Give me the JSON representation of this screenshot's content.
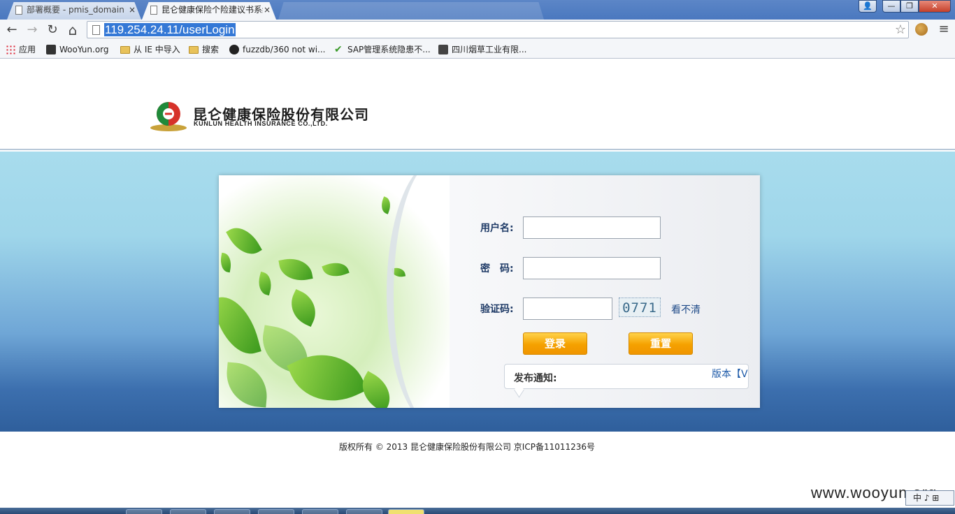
{
  "browser": {
    "tabs": [
      {
        "title": "部署概要 - pmis_domain",
        "close": "×"
      },
      {
        "title": "昆仑健康保险个险建议书系统",
        "close": "×"
      }
    ],
    "window_controls": {
      "minimize": "—",
      "maximize": "❐",
      "close": "✕",
      "user": "👤"
    },
    "nav": {
      "back": "←",
      "forward": "→",
      "reload": "↻",
      "home": "⌂"
    },
    "url": "119.254.24.11/userLogin",
    "bookmark_star": "☆",
    "menu": "≡",
    "bookmarks": [
      {
        "label": "应用",
        "icon": "apps-icon"
      },
      {
        "label": "WooYun.org",
        "icon": "wooyun-icon"
      },
      {
        "label": "从 IE 中导入",
        "icon": "folder-icon"
      },
      {
        "label": "搜索",
        "icon": "folder-icon"
      },
      {
        "label": "fuzzdb/360 not wi...",
        "icon": "github-icon"
      },
      {
        "label": "SAP管理系统隐患不...",
        "icon": "check-icon"
      },
      {
        "label": "四川烟草工业有限...",
        "icon": "photo-icon"
      }
    ]
  },
  "header": {
    "company_cn": "昆仑健康保险股份有限公司",
    "company_en": "KUNLUN HEALTH INSURANCE CO.,LTD."
  },
  "login": {
    "username_label": "用户名:",
    "password_label": "密　码:",
    "captcha_label": "验证码:",
    "username_value": "",
    "password_value": "",
    "captcha_value": "",
    "captcha_image_text": "0771",
    "refresh_captcha": "看不清",
    "login_button": "登录",
    "reset_button": "重置",
    "notice_title": "发布通知:",
    "version_text": "版本【V"
  },
  "footer": {
    "copyright": "版权所有 © 2013 昆仑健康保险股份有限公司 京ICP备11011236号",
    "watermark": "www.wooyun.org"
  },
  "ime": {
    "text": "中 ♪ ⊞"
  },
  "colors": {
    "accent_button": "#f5a100",
    "label_text": "#1e3a66",
    "band_top": "#a8dced",
    "band_bottom": "#2f5f9c"
  }
}
